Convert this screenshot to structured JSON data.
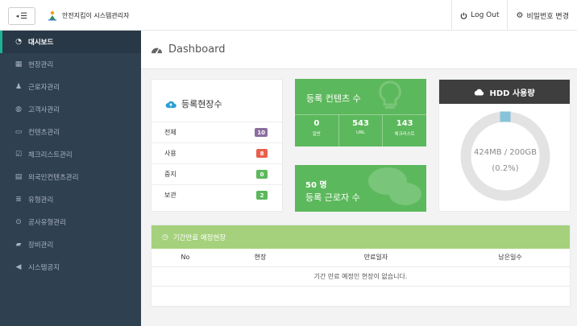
{
  "topbar": {
    "brand": "안전지킴이 시스템관리자",
    "logout": "Log Out",
    "change_password": "비밀번호 변경"
  },
  "sidebar": {
    "items": [
      {
        "label": "대시보드",
        "icon": "dashboard-icon",
        "active": true
      },
      {
        "label": "현장관리",
        "icon": "grid-icon"
      },
      {
        "label": "근로자관리",
        "icon": "user-icon"
      },
      {
        "label": "고객사관리",
        "icon": "globe-icon"
      },
      {
        "label": "컨텐츠관리",
        "icon": "monitor-icon"
      },
      {
        "label": "체크리스트관리",
        "icon": "checkbox-icon"
      },
      {
        "label": "외국인컨텐츠관리",
        "icon": "table-icon"
      },
      {
        "label": "유형관리",
        "icon": "list-icon"
      },
      {
        "label": "공사유형관리",
        "icon": "target-icon"
      },
      {
        "label": "장비관리",
        "icon": "briefcase-icon"
      },
      {
        "label": "시스템공지",
        "icon": "megaphone-icon"
      }
    ]
  },
  "page": {
    "title": "Dashboard"
  },
  "registered_sites": {
    "title": "등록현장수",
    "rows": [
      {
        "label": "전체",
        "value": "10",
        "color": "#8a6d9e"
      },
      {
        "label": "사용",
        "value": "8",
        "color": "#e8604c"
      },
      {
        "label": "중지",
        "value": "0",
        "color": "#5cb85c"
      },
      {
        "label": "보관",
        "value": "2",
        "color": "#5cb85c"
      }
    ]
  },
  "contents": {
    "title": "등록 컨텐츠 수",
    "stats": [
      {
        "value": "0",
        "label": "일반"
      },
      {
        "value": "543",
        "label": "URL"
      },
      {
        "value": "143",
        "label": "체크리스트"
      }
    ]
  },
  "workers": {
    "count": "50 명",
    "label": "등록 근로자 수"
  },
  "hdd": {
    "title": "HDD 사용량",
    "usage": "424MB / 200GB",
    "percent": "(0.2%)",
    "fraction": 0.002
  },
  "expiring": {
    "title": "기간만료 예정현장",
    "columns": [
      "No",
      "현장",
      "만료일자",
      "남은일수"
    ],
    "empty_message": "기간 만료 예정인 현장이 없습니다."
  },
  "colors": {
    "sidebar": "#2f4050",
    "green": "#5cb85c",
    "accent": "#1ab394"
  }
}
